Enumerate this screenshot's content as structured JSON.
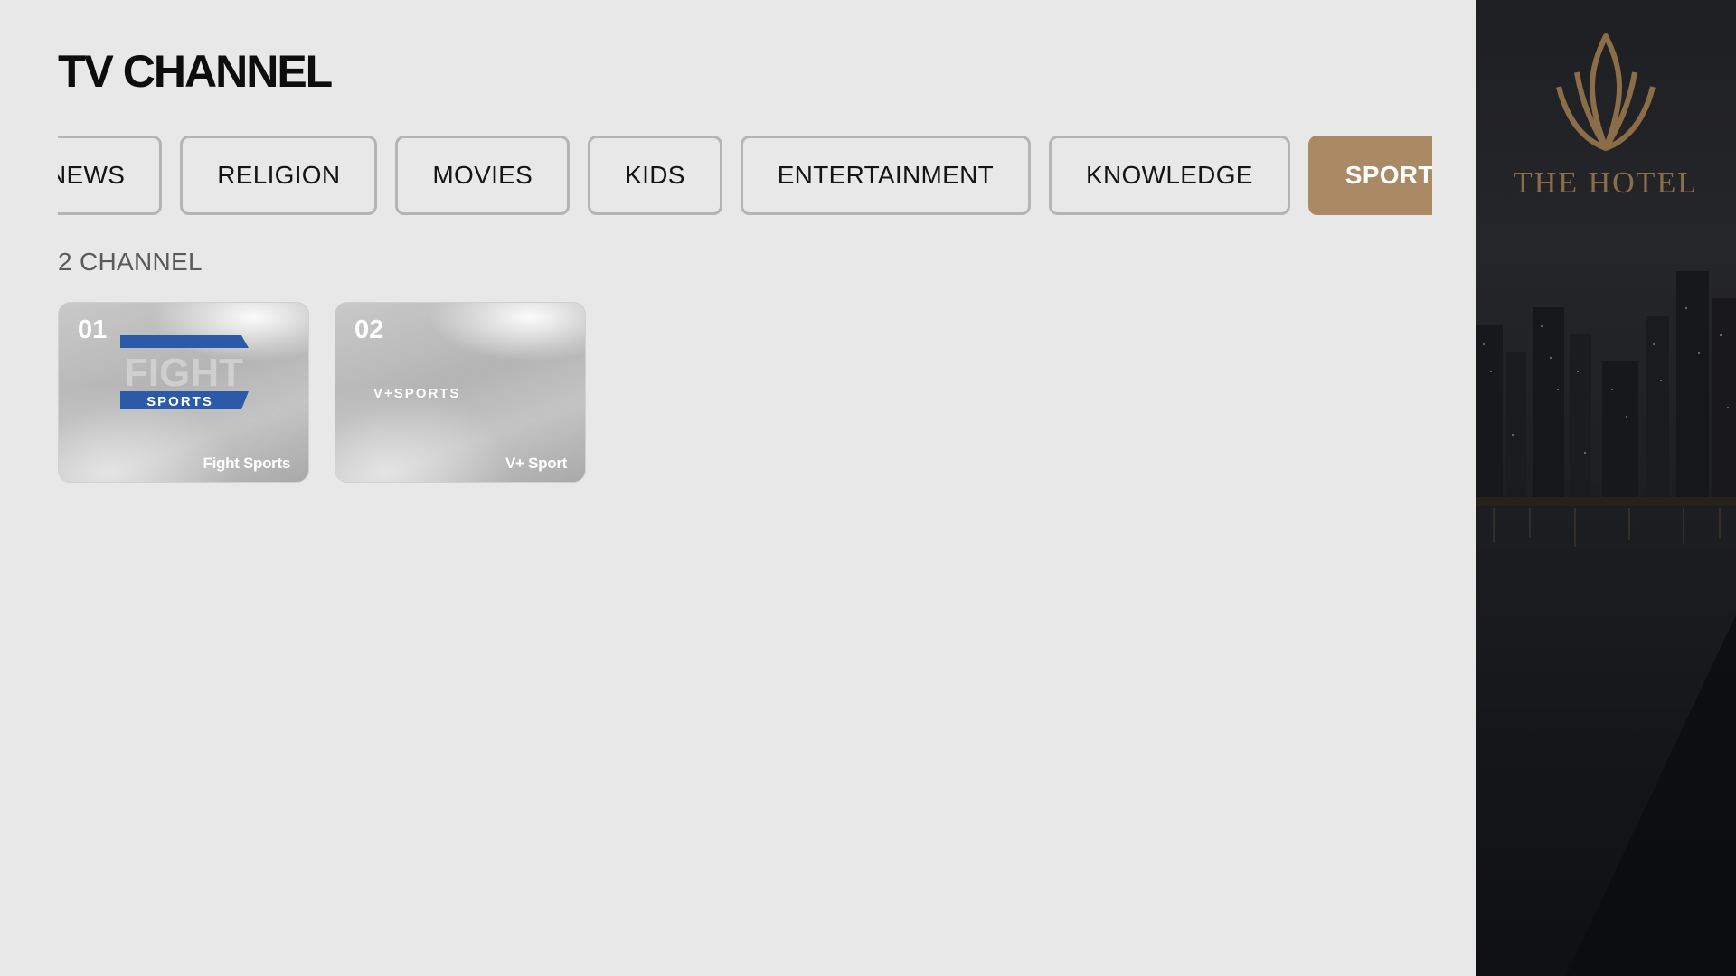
{
  "header": {
    "title": "TV CHANNEL"
  },
  "categories": [
    {
      "label": "NEWS",
      "active": false
    },
    {
      "label": "RELIGION",
      "active": false
    },
    {
      "label": "MOVIES",
      "active": false
    },
    {
      "label": "KIDS",
      "active": false
    },
    {
      "label": "ENTERTAINMENT",
      "active": false
    },
    {
      "label": "KNOWLEDGE",
      "active": false
    },
    {
      "label": "SPORTS",
      "active": true
    }
  ],
  "channel_count": "2 CHANNEL",
  "channels": [
    {
      "number": "01",
      "name": "Fight Sports",
      "logo": {
        "icon": "fight-sports-logo",
        "line1": "FIGHT",
        "line2": "SPORTS"
      }
    },
    {
      "number": "02",
      "name": "V+ Sport",
      "logo": {
        "icon": "vplus-sports-logo",
        "text": "V+SPORTS"
      }
    }
  ],
  "brand": {
    "name": "THE HOTEL",
    "icon": "hotel-crest-icon"
  },
  "colors": {
    "accent": "#a98a64",
    "background": "#e8e8e8",
    "brand_gold": "#8b6e47",
    "fight_blue": "#2b5aa8"
  }
}
